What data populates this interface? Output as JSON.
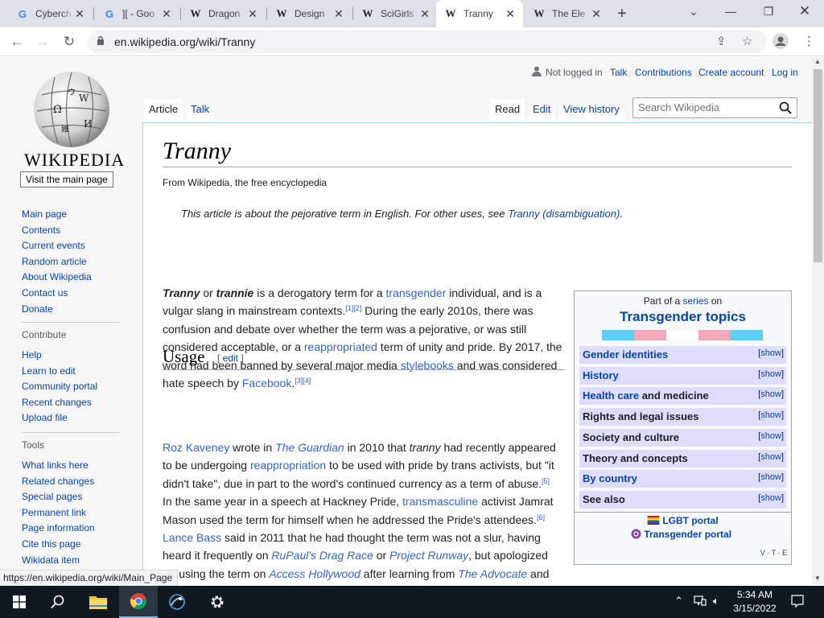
{
  "browser": {
    "tabs": [
      {
        "title": "Cyberch",
        "favicon": "google-g"
      },
      {
        "title": "][ - Goo",
        "favicon": "google-g"
      },
      {
        "title": "Dragon",
        "favicon": "wikipedia-w"
      },
      {
        "title": "Design",
        "favicon": "wikipedia-w"
      },
      {
        "title": "SciGirls",
        "favicon": "wikipedia-w"
      },
      {
        "title": "Tranny",
        "favicon": "wikipedia-w",
        "active": true
      },
      {
        "title": "The Ele",
        "favicon": "wikipedia-w"
      }
    ],
    "url": "en.wikipedia.org/wiki/Tranny",
    "status_url": "https://en.wikipedia.org/wiki/Main_Page"
  },
  "wiki": {
    "wordmark": "WIKIPEDIA",
    "tooltip": "Visit the main page",
    "personal": {
      "not_logged_in": "Not logged in",
      "talk": "Talk",
      "contributions": "Contributions",
      "create_account": "Create account",
      "log_in": "Log in"
    },
    "tabs": {
      "article": "Article",
      "talk": "Talk",
      "read": "Read",
      "edit": "Edit",
      "history": "View history"
    },
    "search_placeholder": "Search Wikipedia",
    "nav": [
      "Main page",
      "Contents",
      "Current events",
      "Random article",
      "About Wikipedia",
      "Contact us",
      "Donate"
    ],
    "contribute": {
      "heading": "Contribute",
      "items": [
        "Help",
        "Learn to edit",
        "Community portal",
        "Recent changes",
        "Upload file"
      ]
    },
    "tools": {
      "heading": "Tools",
      "items": [
        "What links here",
        "Related changes",
        "Special pages",
        "Permanent link",
        "Page information",
        "Cite this page",
        "Wikidata item"
      ]
    }
  },
  "article": {
    "title": "Tranny",
    "tagline": "From Wikipedia, the free encyclopedia",
    "hatnote": {
      "text": "This article is about the pejorative term in English. For other uses, see ",
      "link": "Tranny (disambiguation)",
      "end": "."
    },
    "usage_heading": "Usage",
    "usage_edit": "edit"
  },
  "navbox": {
    "part_of": "Part of a ",
    "series": "series",
    "on": " on",
    "title": "Transgender topics",
    "rows": [
      {
        "label": "Gender identities",
        "link": true
      },
      {
        "label": "History",
        "link": true
      },
      {
        "label": "Health care",
        "suffix": " and medicine",
        "link": true
      },
      {
        "label": "Rights and legal issues",
        "link": false
      },
      {
        "label": "Society and culture",
        "link": false
      },
      {
        "label": "Theory and concepts",
        "link": false
      },
      {
        "label": "By country",
        "link": true
      },
      {
        "label": "See also",
        "link": false
      }
    ],
    "show": "show",
    "portals": [
      "LGBT portal",
      "Transgender portal"
    ],
    "vte": [
      "V",
      "T",
      "E"
    ],
    "flag_colors": [
      "#5BCEFA",
      "#F5A9B8",
      "#FFFFFF",
      "#F5A9B8",
      "#5BCEFA"
    ]
  },
  "taskbar": {
    "time": "5:34 AM",
    "date": "3/15/2022"
  }
}
